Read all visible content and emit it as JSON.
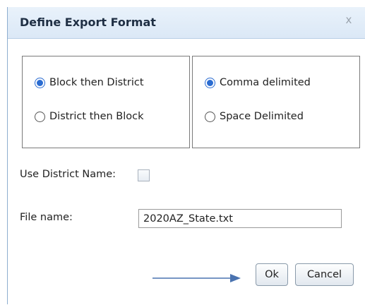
{
  "dialog": {
    "title": "Define Export Format",
    "close_label": "x"
  },
  "order_group": {
    "options": [
      {
        "label": "Block then District",
        "checked": true
      },
      {
        "label": "District then Block",
        "checked": false
      }
    ]
  },
  "delimiter_group": {
    "options": [
      {
        "label": "Comma delimited",
        "checked": true
      },
      {
        "label": "Space Delimited",
        "checked": false
      }
    ]
  },
  "use_district_name": {
    "label": "Use District Name:",
    "checked": false
  },
  "file_name": {
    "label": "File name:",
    "value": "2020AZ_State.txt"
  },
  "buttons": {
    "ok": "Ok",
    "cancel": "Cancel"
  },
  "colors": {
    "titlebar": "#dbe8f6",
    "radio_selected": "#2b6cd1",
    "arrow": "#4a73b0"
  }
}
